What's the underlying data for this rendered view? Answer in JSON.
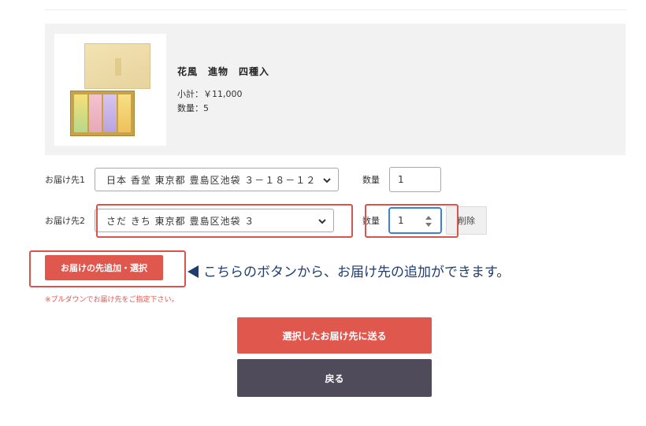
{
  "product": {
    "name": "花風　進物　四種入",
    "subtotal": "小計：￥11,000",
    "quantity": "数量：5"
  },
  "destinations": [
    {
      "label": "お届け先1",
      "selected": "日本 香堂 東京都 豊島区池袋 ３－１８－１２",
      "qty_label": "数量",
      "qty_value": "1"
    },
    {
      "label": "お届け先2",
      "selected": "さだ きち 東京都 豊島区池袋 ３",
      "qty_label": "数量",
      "qty_value": "1",
      "delete_label": "削除"
    }
  ],
  "add_button": "お届けの先追加・選択",
  "callout": "こちらのボタンから、お届け先の追加ができます。",
  "note": "※プルダウンでお届け先をご指定下さい。",
  "submit_button": "選択したお届け先に送る",
  "back_button": "戻る",
  "colors": {
    "accent": "#e0574e",
    "dark_button": "#4f4b5a",
    "callout_text": "#1f3d70",
    "highlight": "#d9534f"
  },
  "icons": {
    "select_arrow": "chevron-down-icon",
    "spinner": "spinner-arrows-icon",
    "callout_pointer": "left-triangle-icon"
  }
}
